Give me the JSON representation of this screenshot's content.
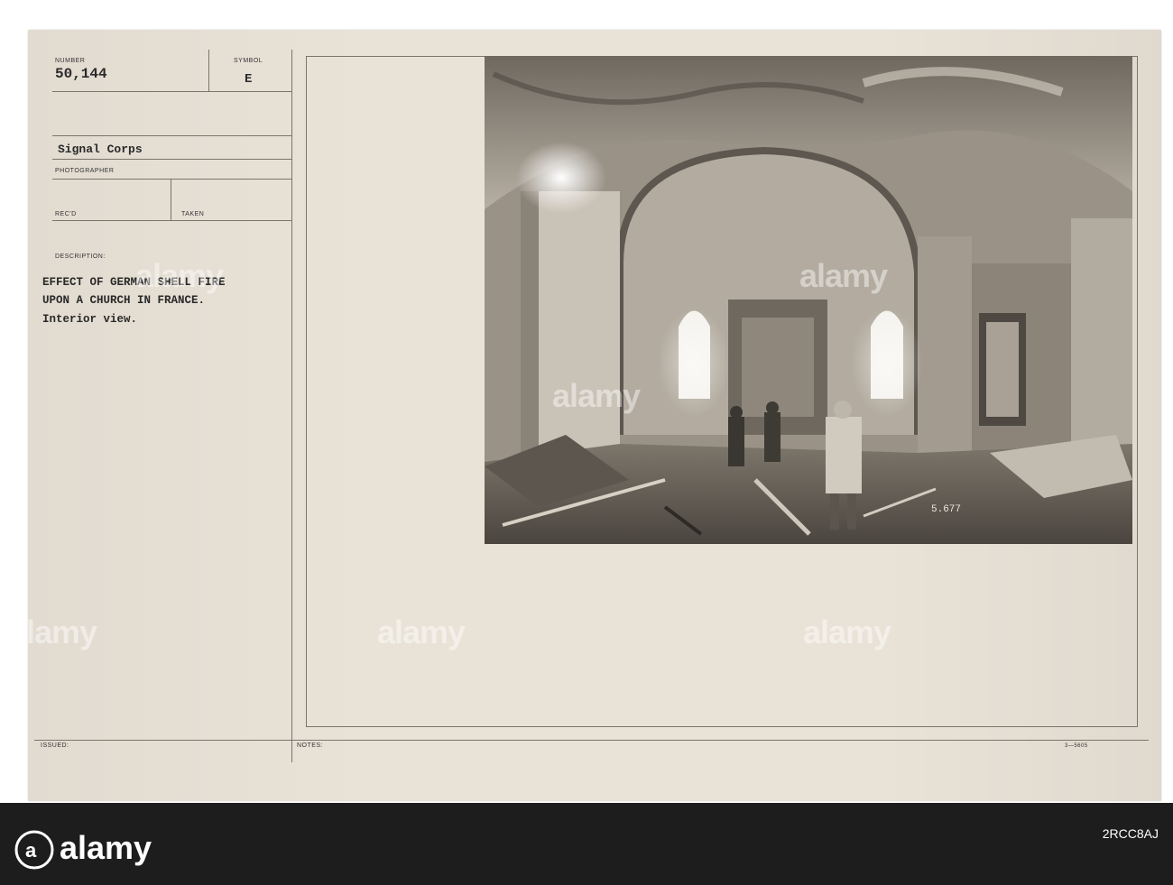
{
  "record": {
    "number_label": "NUMBER",
    "number_value": "50,144",
    "symbol_label": "SYMBOL",
    "symbol_value": "E",
    "source_value": "Signal Corps",
    "photographer_label": "PHOTOGRAPHER",
    "recd_label": "REC'D",
    "taken_label": "TAKEN",
    "description_label": "DESCRIPTION:",
    "description_lines": [
      "EFFECT OF GERMAN SHELL FIRE",
      "UPON A CHURCH IN FRANCE.",
      "Interior view."
    ],
    "issued_label": "ISSUED:",
    "notes_label": "NOTES:",
    "form_code": "3—5605"
  },
  "photo": {
    "subject": "interior of a shell-damaged church with soldiers standing among rubble",
    "plate_number": "5.677"
  },
  "watermark": {
    "text": "alamy",
    "id_text": "2RCC8AJ"
  },
  "colors": {
    "card": "#e9e2d7",
    "strip": "#1d1d1d",
    "ink": "#2a2a2a"
  }
}
